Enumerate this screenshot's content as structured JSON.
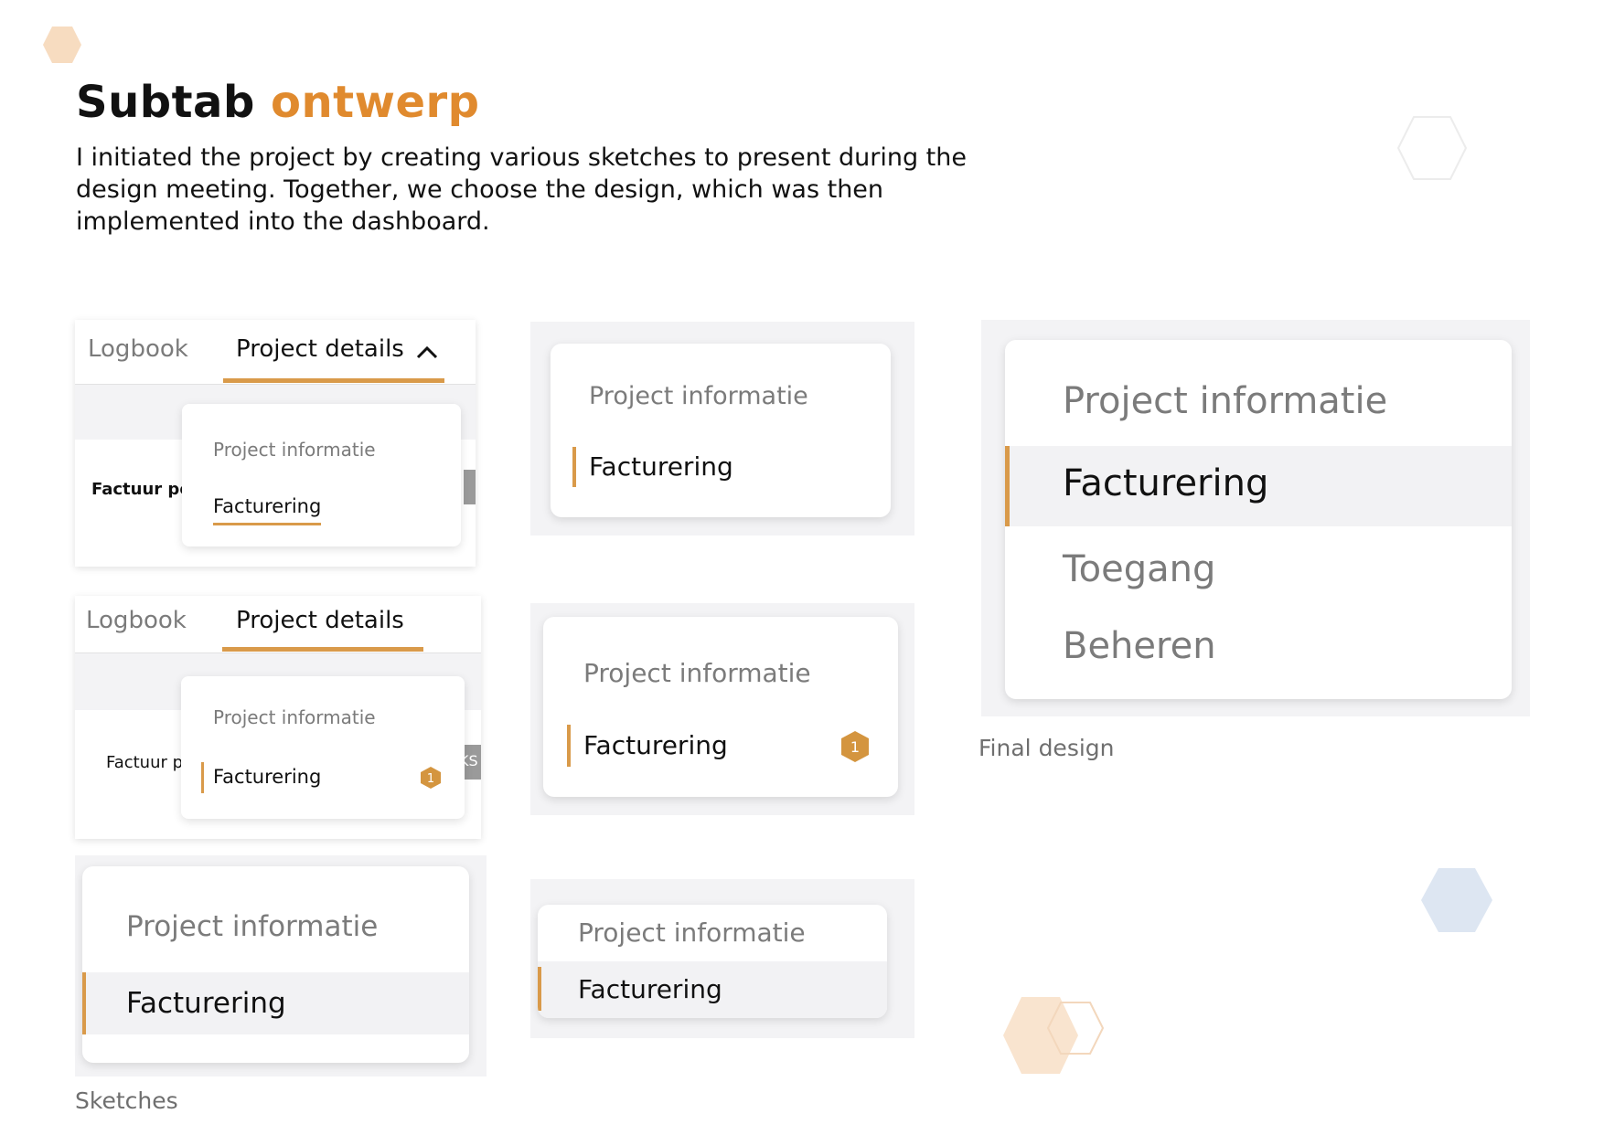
{
  "header": {
    "title_part1": "Subtab",
    "title_part2": "ontwerp",
    "intro": "I initiated the project by creating various sketches to present during the design meeting. Together, we choose the design, which was then implemented into the dashboard."
  },
  "sketch1": {
    "tab_logbook": "Logbook",
    "tab_project_details": "Project details",
    "left_text": "Factuur pe",
    "menu_item_1": "Project informatie",
    "menu_item_2": "Facturering"
  },
  "sketch2": {
    "tab_logbook": "Logbook",
    "tab_project_details": "Project details",
    "left_text": "Factuur p",
    "menu_item_1": "Project informatie",
    "menu_item_2": "Facturering",
    "badge": "1",
    "peek_text": "KS"
  },
  "sketch3": {
    "menu_item_1": "Project informatie",
    "menu_item_2": "Facturering"
  },
  "sketch4": {
    "menu_item_1": "Project informatie",
    "menu_item_2": "Facturering"
  },
  "sketch5": {
    "menu_item_1": "Project informatie",
    "menu_item_2": "Facturering",
    "badge": "1"
  },
  "sketch6": {
    "menu_item_1": "Project informatie",
    "menu_item_2": "Facturering"
  },
  "final": {
    "items": [
      "Project informatie",
      "Facturering",
      "Toegang",
      "Beheren"
    ],
    "caption": "Final design"
  },
  "sketches_caption": "Sketches",
  "colors": {
    "accent": "#e08a2e",
    "bar": "#d99a4a",
    "badge": "#d4953f"
  }
}
